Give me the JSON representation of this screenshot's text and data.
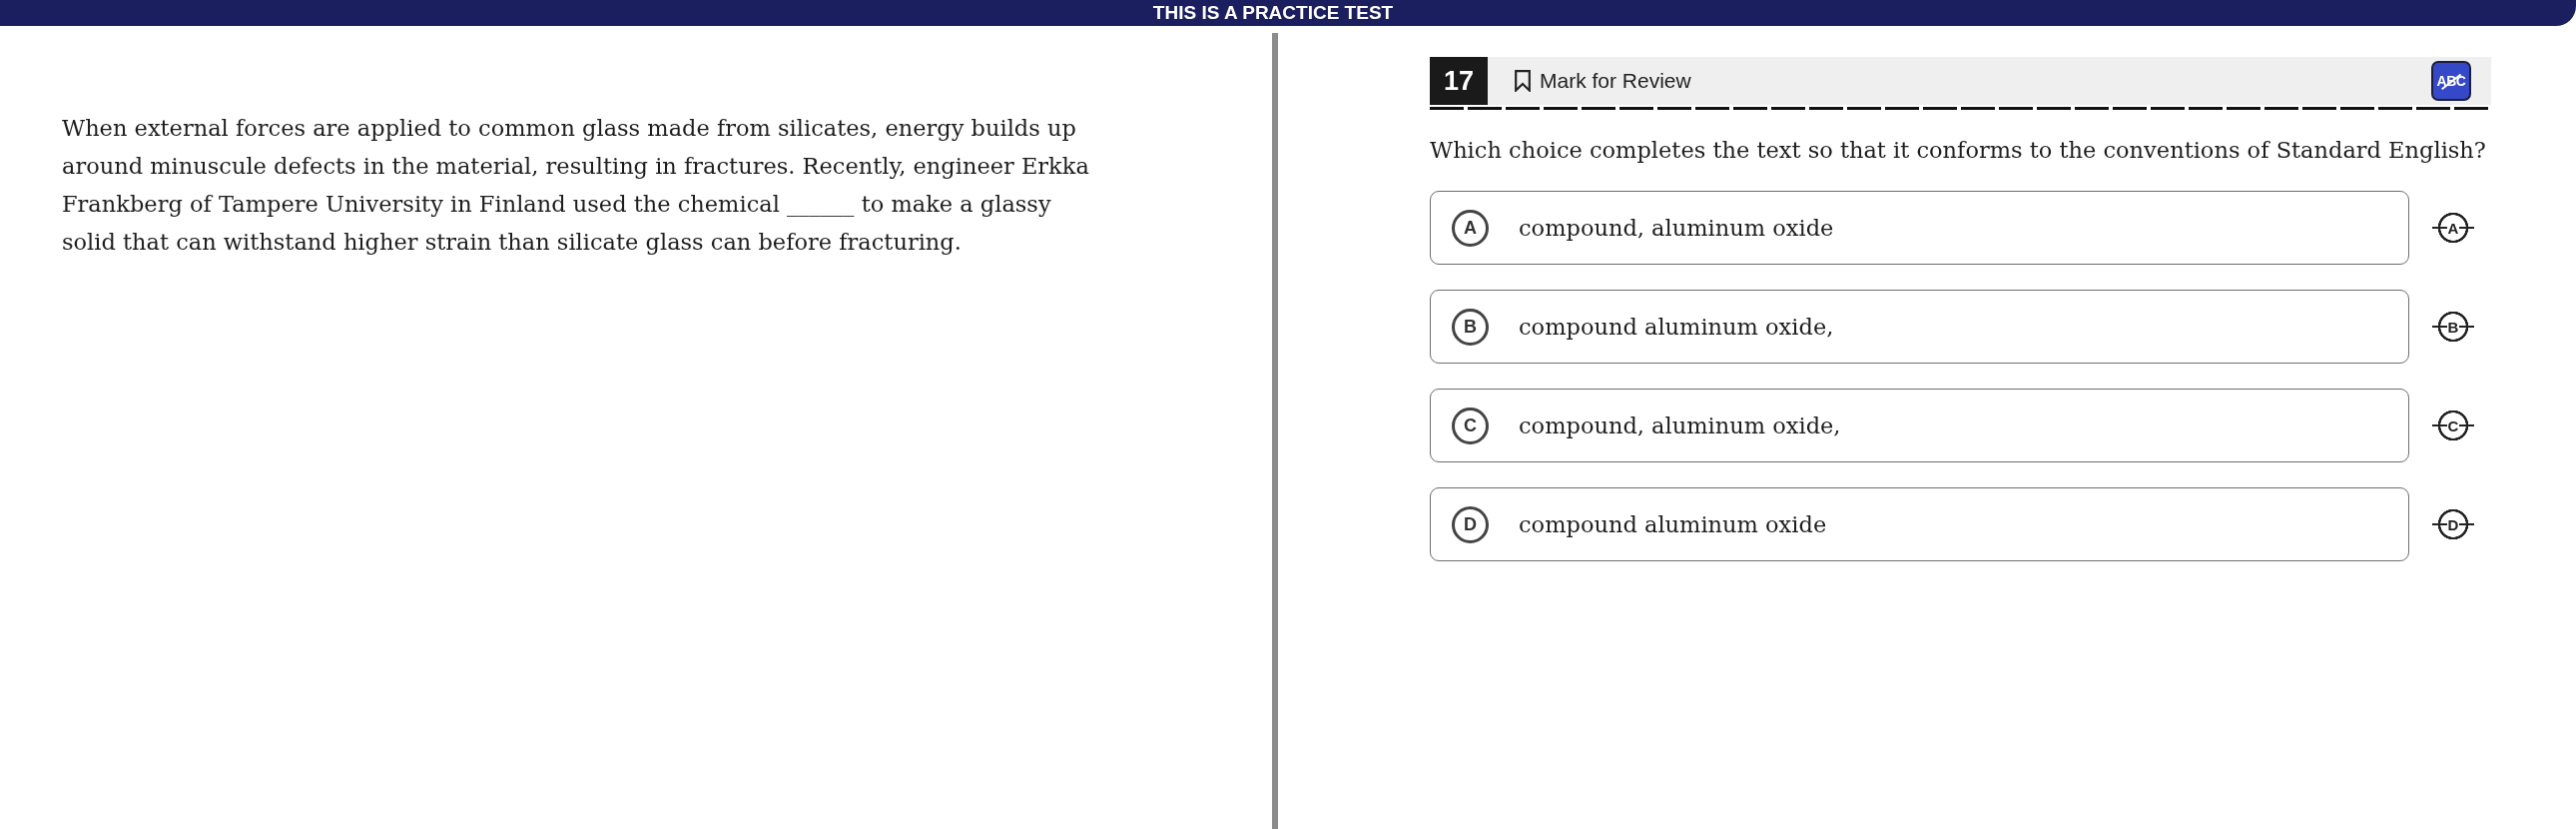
{
  "banner": {
    "text": "THIS IS A PRACTICE TEST"
  },
  "passage": {
    "text": "When external forces are applied to common glass made from silicates, energy builds up around minuscule defects in the material, resulting in fractures. Recently, engineer Erkka Frankberg of Tampere University in Finland used the chemical ______ to make a glassy solid that can withstand higher strain than silicate glass can before fracturing."
  },
  "question_header": {
    "number": "17",
    "mark_for_review": {
      "label": "Mark for Review",
      "marked": false
    },
    "eliminator": {
      "label": "ABC",
      "on": true
    }
  },
  "question": {
    "prompt": "Which choice completes the text so that it conforms to the conventions of Standard English?"
  },
  "options": [
    {
      "letter": "A",
      "text": "compound, aluminum oxide",
      "selected": false,
      "strike_label": "A"
    },
    {
      "letter": "B",
      "text": "compound aluminum oxide,",
      "selected": false,
      "strike_label": "B"
    },
    {
      "letter": "C",
      "text": "compound, aluminum oxide,",
      "selected": false,
      "strike_label": "C"
    },
    {
      "letter": "D",
      "text": "compound aluminum oxide",
      "selected": false,
      "strike_label": "D"
    }
  ]
}
